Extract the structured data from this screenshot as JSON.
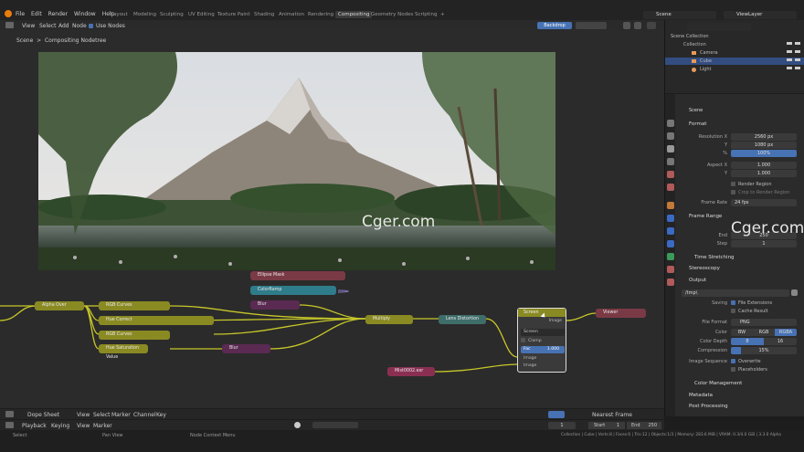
{
  "menu": [
    "File",
    "Edit",
    "Render",
    "Window",
    "Help"
  ],
  "workspaces": [
    "Layout",
    "Modeling",
    "Sculpting",
    "UV Editing",
    "Texture Paint",
    "Shading",
    "Animation",
    "Rendering",
    "Compositing",
    "Geometry Nodes",
    "Scripting",
    "+"
  ],
  "scene_field": "Scene",
  "viewlayer_field": "ViewLayer",
  "editor_menu": [
    "View",
    "Select",
    "Add",
    "Node"
  ],
  "use_nodes": "Use Nodes",
  "backdrop": "Backdrop",
  "breadcrumb": [
    "Scene",
    "Compositing Nodetree"
  ],
  "watermark": "Cger.com",
  "nodes": [
    "Ellipse Mask",
    "ColorRamp",
    "Blur",
    "Alpha Over",
    "RGB Curves",
    "Hue Correct",
    "RGB Curves",
    "Hue Saturation Value",
    "Blur",
    "Multiply",
    "Lens Distortion",
    "Screen",
    "Viewer",
    "Mist0002.exr"
  ],
  "screen_node": {
    "title": "Screen",
    "out": "Image",
    "mode": "Screen",
    "clamp": "Clamp",
    "fac_label": "Fac",
    "fac": "1.000",
    "in1": "Image",
    "in2": "Image"
  },
  "outliner": {
    "root": "Scene Collection",
    "collection": "Collection",
    "items": [
      "Camera",
      "Cube",
      "Light"
    ]
  },
  "props": {
    "context": "Scene",
    "format": "Format",
    "res_x_label": "Resolution X",
    "res_x": "2560 px",
    "res_y_label": "Y",
    "res_y": "1080 px",
    "pct_label": "%",
    "pct": "100%",
    "asp_x_label": "Aspect X",
    "asp_x": "1.000",
    "asp_y_label": "Y",
    "asp_y": "1.000",
    "render_region": "Render Region",
    "crop": "Crop to Render Region",
    "frame_rate_label": "Frame Rate",
    "frame_rate": "24 fps",
    "frame_range": "Frame Range",
    "end_label": "End",
    "end": "250",
    "step_label": "Step",
    "step": "1",
    "time_stretching": "Time Stretching",
    "stereoscopy": "Stereoscopy",
    "output": "Output",
    "path": "/tmp\\",
    "saving_label": "Saving",
    "file_ext": "File Extensions",
    "cache": "Cache Result",
    "file_format_label": "File Format",
    "file_format": "PNG",
    "color_label": "Color",
    "color_opts": [
      "BW",
      "RGB",
      "RGBA"
    ],
    "depth_label": "Color Depth",
    "depth_opts": [
      "8",
      "16"
    ],
    "compression_label": "Compression",
    "compression": "15%",
    "img_seq_label": "Image Sequence",
    "overwrite": "Overwrite",
    "placeholders": "Placeholders",
    "color_mgmt": "Color Management",
    "metadata": "Metadata",
    "post": "Post Processing"
  },
  "dopesheet": {
    "mode": "Dope Sheet",
    "menu": [
      "View",
      "Select",
      "Marker",
      "Channel",
      "Key"
    ],
    "snap": "Nearest Frame"
  },
  "timeline": {
    "menu": [
      "Playback",
      "Keying",
      "View",
      "Marker"
    ],
    "frame": "1",
    "start_label": "Start",
    "start": "1",
    "end_label": "End",
    "end": "250"
  },
  "status": {
    "left": "Select",
    "mid": "Pan View",
    "ctx": "Node Context Menu",
    "right": "Collection | Cube | Verts:8 | Faces:6 | Tris:12 | Objects:1/3 | Memory: 283.6 MiB | VRAM: 0.3/4.0 GiB | 3.3.0 Alpha"
  }
}
